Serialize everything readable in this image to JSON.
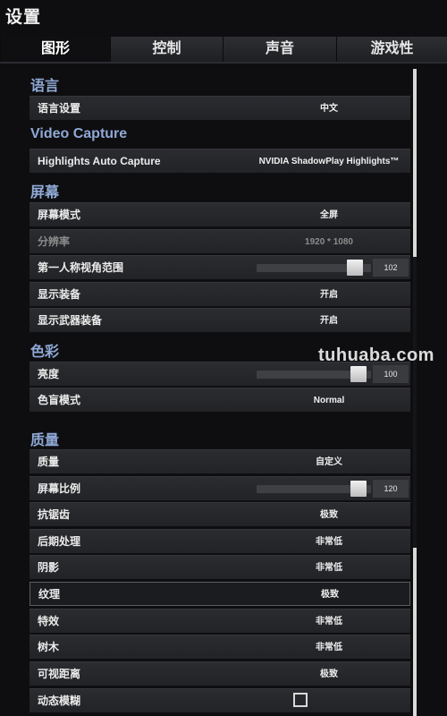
{
  "window": {
    "title": "设置"
  },
  "tabs": [
    {
      "label": "图形",
      "active": true
    },
    {
      "label": "控制",
      "active": false
    },
    {
      "label": "声音",
      "active": false
    },
    {
      "label": "游戏性",
      "active": false
    }
  ],
  "sections": {
    "language": "语言",
    "video_capture": "Video Capture",
    "screen": "屏幕",
    "color": "色彩",
    "quality": "质量"
  },
  "settings": {
    "language_setting": {
      "label": "语言设置",
      "value": "中文"
    },
    "highlights_auto_capture": {
      "label": "Highlights Auto Capture",
      "value": "NVIDIA ShadowPlay Highlights™"
    },
    "screen_mode": {
      "label": "屏幕模式",
      "value": "全屏"
    },
    "resolution": {
      "label": "分辨率",
      "value": "1920 * 1080",
      "disabled": true
    },
    "fov": {
      "label": "第一人称视角范围",
      "value": "102",
      "fill_fraction": 0.92
    },
    "show_equipment": {
      "label": "显示装备",
      "value": "开启"
    },
    "show_weapon_equipment": {
      "label": "显示武器装备",
      "value": "开启"
    },
    "brightness": {
      "label": "亮度",
      "value": "100",
      "fill_fraction": 0.95
    },
    "colorblind_mode": {
      "label": "色盲模式",
      "value": "Normal"
    },
    "quality": {
      "label": "质量",
      "value": "自定义"
    },
    "screen_scale": {
      "label": "屏幕比例",
      "value": "120",
      "fill_fraction": 0.95
    },
    "anti_aliasing": {
      "label": "抗锯齿",
      "value": "极致"
    },
    "post_processing": {
      "label": "后期处理",
      "value": "非常低"
    },
    "shadows": {
      "label": "阴影",
      "value": "非常低"
    },
    "textures": {
      "label": "纹理",
      "value": "极致"
    },
    "effects": {
      "label": "特效",
      "value": "非常低"
    },
    "foliage": {
      "label": "树木",
      "value": "非常低"
    },
    "view_distance": {
      "label": "可视距离",
      "value": "极致"
    },
    "motion_blur": {
      "label": "动态模糊",
      "checked": false
    }
  },
  "watermark": "tuhuaba.com"
}
